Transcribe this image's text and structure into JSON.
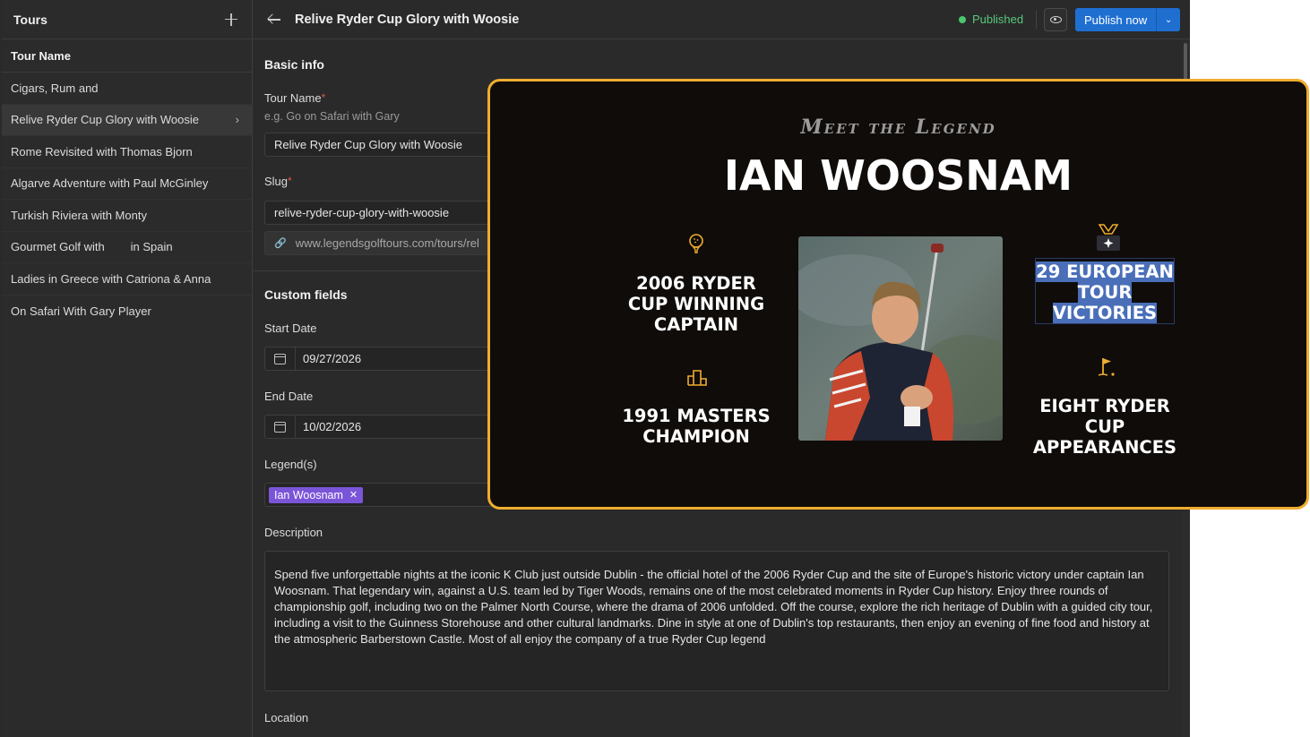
{
  "sidebar": {
    "title": "Tours",
    "column_header": "Tour Name",
    "items": [
      {
        "label": "Cigars, Rum and"
      },
      {
        "label": "Relive Ryder Cup Glory with Woosie",
        "active": true
      },
      {
        "label": "Rome Revisited with Thomas Bjorn"
      },
      {
        "label": "Algarve Adventure with Paul McGinley"
      },
      {
        "label": "Turkish Riviera with Monty"
      },
      {
        "label": "Gourmet Golf with        in Spain"
      },
      {
        "label": "Ladies in Greece with Catriona & Anna"
      },
      {
        "label": "On Safari With Gary Player"
      }
    ]
  },
  "header": {
    "title": "Relive Ryder Cup Glory with Woosie",
    "status": "Published",
    "status_color": "#4cc66b",
    "publish_label": "Publish now",
    "accent_color": "#1f6fd1"
  },
  "basic_info": {
    "section_title": "Basic info",
    "tour_name_label": "Tour Name",
    "tour_name_hint": "e.g. Go on Safari with Gary",
    "tour_name_value": "Relive Ryder Cup Glory with Woosie",
    "slug_label": "Slug",
    "slug_value": "relive-ryder-cup-glory-with-woosie",
    "url_value": "www.legendsgolftours.com/tours/rel"
  },
  "custom_fields": {
    "section_title": "Custom fields",
    "start_date_label": "Start Date",
    "start_date_value": "09/27/2026",
    "end_date_label": "End Date",
    "end_date_value": "10/02/2026",
    "legends_label": "Legend(s)",
    "legend_tag": "Ian Woosnam",
    "description_label": "Description",
    "description_value": "Spend five unforgettable nights at the iconic K Club just outside Dublin - the official hotel of the 2006 Ryder Cup and the site of Europe's historic victory under captain Ian Woosnam. That legendary win, against a U.S. team led by Tiger Woods, remains one of the most celebrated moments in Ryder Cup history. Enjoy three rounds of championship golf, including two on the Palmer North Course, where the drama of 2006 unfolded. Off the course, explore the rich heritage of Dublin with a guided city tour, including a visit to the Guinness Storehouse and other cultural landmarks. Dine in style at one of Dublin's top restaurants, then enjoy an evening of fine food and history at the atmospheric Barberstown Castle. Most of all enjoy the company of a true Ryder Cup legend",
    "location_label": "Location"
  },
  "legend_card": {
    "kicker": "Meet the Legend",
    "name": "IAN WOOSNAM",
    "accent_color": "#f0ad2e",
    "stats": [
      {
        "line1": "2006 RYDER",
        "line2": "CUP WINNING",
        "line3": "CAPTAIN",
        "icon": "golf-ball-tee-icon"
      },
      {
        "line1": "1991 MASTERS",
        "line2": "CHAMPION",
        "icon": "podium-icon"
      },
      {
        "line1": "29 EUROPEAN",
        "line2": "TOUR",
        "line3": "VICTORIES",
        "icon": "medal-icon"
      },
      {
        "line1": "EIGHT RYDER",
        "line2": "CUP",
        "line3": "APPEARANCES",
        "icon": "golf-flag-icon"
      }
    ]
  }
}
